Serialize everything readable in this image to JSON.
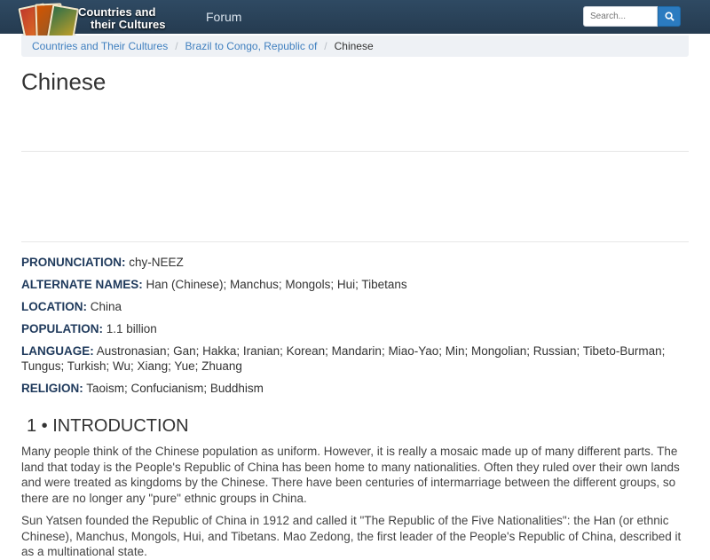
{
  "header": {
    "logo_line1": "Countries and",
    "logo_line2": "their Cultures",
    "forum_label": "Forum",
    "search_placeholder": "Search..."
  },
  "breadcrumb": {
    "items": [
      "Countries and Their Cultures",
      "Brazil to Congo, Republic of"
    ],
    "current": "Chinese"
  },
  "page_title": "Chinese",
  "facts": [
    {
      "label": "PRONUNCIATION:",
      "value": "chy-NEEZ"
    },
    {
      "label": "ALTERNATE NAMES:",
      "value": "Han (Chinese); Manchus; Mongols; Hui; Tibetans"
    },
    {
      "label": "LOCATION:",
      "value": "China"
    },
    {
      "label": "POPULATION:",
      "value": "1.1 billion"
    },
    {
      "label": "LANGUAGE:",
      "value": "Austronasian; Gan; Hakka; Iranian; Korean; Mandarin; Miao-Yao; Min; Mongolian; Russian; Tibeto-Burman; Tungus; Turkish; Wu; Xiang; Yue; Zhuang"
    },
    {
      "label": "RELIGION:",
      "value": "Taoism; Confucianism; Buddhism"
    }
  ],
  "section": {
    "number": "1 •",
    "title": "INTRODUCTION"
  },
  "paragraphs": [
    "Many people think of the Chinese population as uniform. However, it is really a mosaic made up of many different parts. The land that today is the People's Republic of China has been home to many nationalities. Often they ruled over their own lands and were treated as kingdoms by the Chinese. There have been centuries of intermarriage between the different groups, so there are no longer any \"pure\" ethnic groups in China.",
    "Sun Yatsen founded the Republic of China in 1912 and called it \"The Republic of the Five Nationalities\": the Han (or ethnic Chinese), Manchus, Mongols, Hui, and Tibetans. Mao Zedong, the first leader of the People's Republic of China, described it as a multinational state."
  ],
  "colors": {
    "navbar": "#2f4a63",
    "link": "#3f7fbf",
    "label": "#1f3a5c",
    "search_button": "#2b7bc0"
  }
}
